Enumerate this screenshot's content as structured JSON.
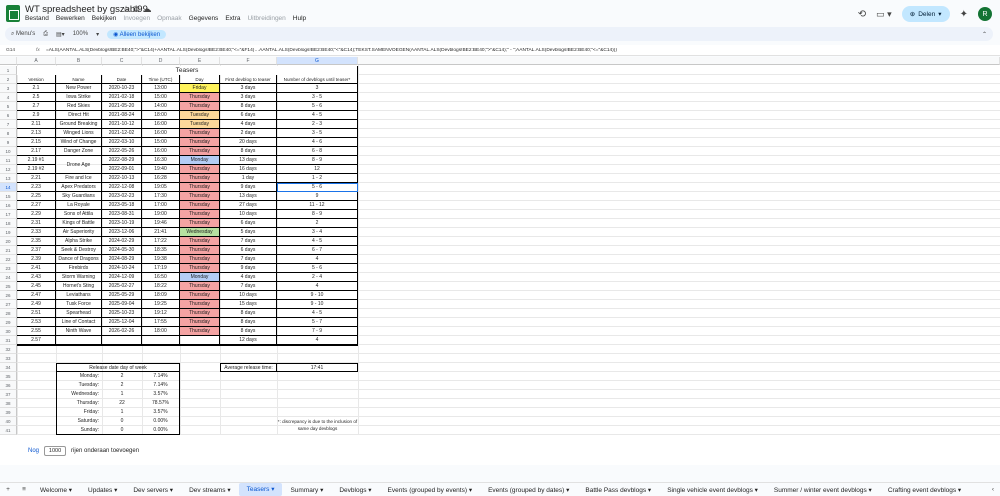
{
  "app": {
    "title": "WT spreadsheet by gszabi99",
    "avatar_letter": "R",
    "share_label": "Delen"
  },
  "menu": [
    "Bestand",
    "Bewerken",
    "Bekijken",
    "Invoegen",
    "Opmaak",
    "Gegevens",
    "Extra",
    "Uitbreidingen",
    "Hulp"
  ],
  "menu_disabled": [
    3,
    4,
    7
  ],
  "toolbar": {
    "search_label": "Menu's",
    "zoom": "100%",
    "view_only": "Alleen bekijken"
  },
  "formula_bar": {
    "cell_ref": "G14",
    "formula": "=ALS(AANTAL.ALS(Devblogs!BE2:BE40;\">\"&C14)+AANTAL.ALS(Devblogs!BE2:BE40;\"<=\"&F14)…AANTAL.ALS(Devblogs!BE2:BE40;\"<\"&C14);TEKST.SAMENVOEGEN(AANTAL.ALS(Devblogs!BE2:BE40;\">\"&C14);\" - \";AANTAL.ALS(Devblogs!BE2:BE40;\"<=\"&C14)))"
  },
  "columns": [
    "A",
    "B",
    "C",
    "D",
    "E",
    "F",
    "G"
  ],
  "sheet": {
    "title": "Teasers",
    "headers": [
      "Version",
      "Name",
      "Date",
      "Time (UTC)",
      "Day",
      "First devblog to teaser",
      "Number of devblogs until teaser*"
    ],
    "rows": [
      [
        "2.1",
        "New Power",
        "2020-10-23",
        "13:00",
        "Friday",
        "3 days",
        "3"
      ],
      [
        "2.5",
        "Ixwa Strike",
        "2021-02-18",
        "15:00",
        "Thursday",
        "3 days",
        "3 - 5"
      ],
      [
        "2.7",
        "Red Skies",
        "2021-05-20",
        "14:00",
        "Thursday",
        "8 days",
        "5 - 6"
      ],
      [
        "2.9",
        "Direct Hit",
        "2021-08-24",
        "18:00",
        "Tuesday",
        "6 days",
        "4 - 5"
      ],
      [
        "2.11",
        "Ground Breaking",
        "2021-10-12",
        "16:00",
        "Tuesday",
        "4 days",
        "2 - 3"
      ],
      [
        "2.13",
        "Winged Lions",
        "2021-12-02",
        "16:00",
        "Thursday",
        "2 days",
        "3 - 5"
      ],
      [
        "2.15",
        "Wind of Change",
        "2022-03-10",
        "15:00",
        "Thursday",
        "20 days",
        "4 - 6"
      ],
      [
        "2.17",
        "Danger Zone",
        "2022-05-26",
        "16:00",
        "Thursday",
        "8 days",
        "6 - 8"
      ],
      [
        "2.19 #1",
        "",
        "2022-08-29",
        "16:30",
        "Monday",
        "13 days",
        "8 - 9"
      ],
      [
        "2.19 #2",
        "",
        "2022-09-01",
        "19:40",
        "Thursday",
        "16 days",
        "12"
      ],
      [
        "2.21",
        "Fire and Ice",
        "2022-10-13",
        "16:28",
        "Thursday",
        "1 day",
        "1 - 2"
      ],
      [
        "2.23",
        "Apex Predators",
        "2022-12-08",
        "19:05",
        "Thursday",
        "9 days",
        "5 - 6"
      ],
      [
        "2.25",
        "Sky Guardians",
        "2023-02-23",
        "17:30",
        "Thursday",
        "13 days",
        "9"
      ],
      [
        "2.27",
        "La Royale",
        "2023-05-18",
        "17:00",
        "Thursday",
        "27 days",
        "11 - 12"
      ],
      [
        "2.29",
        "Sons of Attila",
        "2023-08-31",
        "19:00",
        "Thursday",
        "10 days",
        "8 - 9"
      ],
      [
        "2.31",
        "Kings of Battle",
        "2023-10-19",
        "19:46",
        "Thursday",
        "6 days",
        "2"
      ],
      [
        "2.33",
        "Air Superiority",
        "2023-12-06",
        "21:41",
        "Wednesday",
        "5 days",
        "3 - 4"
      ],
      [
        "2.35",
        "Alpha Strike",
        "2024-02-29",
        "17:22",
        "Thursday",
        "7 days",
        "4 - 5"
      ],
      [
        "2.37",
        "Seek & Destroy",
        "2024-05-30",
        "18:35",
        "Thursday",
        "6 days",
        "6 - 7"
      ],
      [
        "2.39",
        "Dance of Dragons",
        "2024-08-29",
        "19:38",
        "Thursday",
        "7 days",
        "4"
      ],
      [
        "2.41",
        "Firebirds",
        "2024-10-24",
        "17:19",
        "Thursday",
        "9 days",
        "5 - 6"
      ],
      [
        "2.43",
        "Storm Warning",
        "2024-12-09",
        "16:50",
        "Monday",
        "4 days",
        "2 - 4"
      ],
      [
        "2.45",
        "Hornet's Sting",
        "2025-02-27",
        "18:22",
        "Thursday",
        "7 days",
        "4"
      ],
      [
        "2.47",
        "Leviathans",
        "2025-05-29",
        "18:09",
        "Thursday",
        "10 days",
        "9 - 10"
      ],
      [
        "2.49",
        "Tusk Force",
        "2025-09-04",
        "19:25",
        "Thursday",
        "15 days",
        "9 - 10"
      ],
      [
        "2.51",
        "Spearhead",
        "2025-10-23",
        "19:12",
        "Thursday",
        "8 days",
        "4 - 5"
      ],
      [
        "2.53",
        "Line of Contact",
        "2025-12-04",
        "17:55",
        "Thursday",
        "8 days",
        "5 - 7"
      ],
      [
        "2.55",
        "Ninth Wave",
        "2026-02-26",
        "18:00",
        "Thursday",
        "8 days",
        "7 - 9"
      ],
      [
        "2.57",
        "",
        "",
        "",
        "",
        "12 days",
        "4"
      ]
    ],
    "merged_name": "Drone Age",
    "day_colors": {
      "Friday": "#fff35c",
      "Thursday": "#f4a3a3",
      "Tuesday": "#fcd89a",
      "Monday": "#b4cdf5",
      "Wednesday": "#b7e1a1"
    },
    "release_title": "Release date day of week",
    "release": [
      [
        "Monday:",
        "2",
        "7.14%"
      ],
      [
        "Tuesday:",
        "2",
        "7.14%"
      ],
      [
        "Wednesday:",
        "1",
        "3.57%"
      ],
      [
        "Thursday:",
        "22",
        "78.57%"
      ],
      [
        "Friday:",
        "1",
        "3.57%"
      ],
      [
        "Saturday:",
        "0",
        "0.00%"
      ],
      [
        "Sunday:",
        "0",
        "0.00%"
      ]
    ],
    "avg_label": "Average release time:",
    "avg_value": "17:41",
    "footnote": "*: discrepancy is due to the inclusion of same day devblogs",
    "row_numbers": [
      "1",
      "2",
      "3",
      "4",
      "5",
      "6",
      "7",
      "8",
      "9",
      "10",
      "11",
      "12",
      "13",
      "14",
      "15",
      "16",
      "17",
      "18",
      "19",
      "20",
      "21",
      "22",
      "23",
      "24",
      "25",
      "26",
      "27",
      "28",
      "29",
      "30",
      "31",
      "32",
      "33",
      "34",
      "35",
      "36",
      "37",
      "38",
      "39",
      "40",
      "41"
    ]
  },
  "add_rows": {
    "button": "Nog",
    "value": "1000",
    "suffix": "rijen onderaan toevoegen"
  },
  "tabs": [
    "Welcome",
    "Updates",
    "Dev servers",
    "Dev streams",
    "Teasers",
    "Summary",
    "Devblogs",
    "Events (grouped by events)",
    "Events (grouped by dates)",
    "Battle Pass devblogs",
    "Single vehicle event devblogs",
    "Summer / winter event devblogs",
    "Crafting event devblogs"
  ],
  "active_tab": "Teasers"
}
